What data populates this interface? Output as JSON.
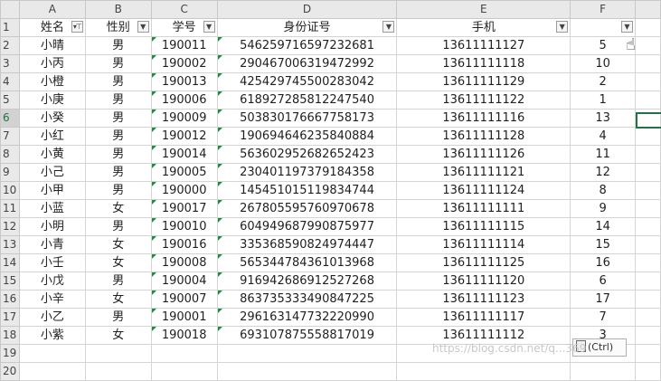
{
  "columns": [
    {
      "letter": "A",
      "header": "姓名",
      "filter_state": "filtered"
    },
    {
      "letter": "B",
      "header": "性别",
      "filter_state": "normal"
    },
    {
      "letter": "C",
      "header": "学号",
      "filter_state": "normal"
    },
    {
      "letter": "D",
      "header": "身份证号",
      "filter_state": "normal"
    },
    {
      "letter": "E",
      "header": "手机",
      "filter_state": "normal"
    },
    {
      "letter": "F",
      "header": "",
      "filter_state": "normal"
    }
  ],
  "rows": [
    {
      "num": "2",
      "name": "小晴",
      "gender": "男",
      "sid": "190011",
      "idcard": "546259716597232681",
      "phone": "13611111127",
      "f": "5"
    },
    {
      "num": "3",
      "name": "小丙",
      "gender": "男",
      "sid": "190002",
      "idcard": "290467006319472992",
      "phone": "13611111118",
      "f": "10"
    },
    {
      "num": "4",
      "name": "小橙",
      "gender": "男",
      "sid": "190013",
      "idcard": "425429745500283042",
      "phone": "13611111129",
      "f": "2"
    },
    {
      "num": "5",
      "name": "小庚",
      "gender": "男",
      "sid": "190006",
      "idcard": "618927285812247540",
      "phone": "13611111122",
      "f": "1"
    },
    {
      "num": "6",
      "name": "小癸",
      "gender": "男",
      "sid": "190009",
      "idcard": "503830176667758173",
      "phone": "13611111116",
      "f": "13"
    },
    {
      "num": "7",
      "name": "小红",
      "gender": "男",
      "sid": "190012",
      "idcard": "190694646235840884",
      "phone": "13611111128",
      "f": "4"
    },
    {
      "num": "8",
      "name": "小黄",
      "gender": "男",
      "sid": "190014",
      "idcard": "563602952682652423",
      "phone": "13611111126",
      "f": "11"
    },
    {
      "num": "9",
      "name": "小己",
      "gender": "男",
      "sid": "190005",
      "idcard": "230401197379184358",
      "phone": "13611111121",
      "f": "12"
    },
    {
      "num": "10",
      "name": "小甲",
      "gender": "男",
      "sid": "190000",
      "idcard": "145451015119834744",
      "phone": "13611111124",
      "f": "8"
    },
    {
      "num": "11",
      "name": "小蓝",
      "gender": "女",
      "sid": "190017",
      "idcard": "267805595760970678",
      "phone": "13611111111",
      "f": "9"
    },
    {
      "num": "12",
      "name": "小明",
      "gender": "男",
      "sid": "190010",
      "idcard": "604949687990875977",
      "phone": "13611111115",
      "f": "14"
    },
    {
      "num": "13",
      "name": "小青",
      "gender": "女",
      "sid": "190016",
      "idcard": "335368590824974447",
      "phone": "13611111114",
      "f": "15"
    },
    {
      "num": "14",
      "name": "小壬",
      "gender": "女",
      "sid": "190008",
      "idcard": "565344784361013968",
      "phone": "13611111125",
      "f": "16"
    },
    {
      "num": "15",
      "name": "小戊",
      "gender": "男",
      "sid": "190004",
      "idcard": "916942686912527268",
      "phone": "13611111120",
      "f": "6"
    },
    {
      "num": "16",
      "name": "小辛",
      "gender": "女",
      "sid": "190007",
      "idcard": "863735333490847225",
      "phone": "13611111123",
      "f": "17"
    },
    {
      "num": "17",
      "name": "小乙",
      "gender": "男",
      "sid": "190001",
      "idcard": "296163147732220990",
      "phone": "13611111117",
      "f": "7"
    },
    {
      "num": "18",
      "name": "小紫",
      "gender": "女",
      "sid": "190018",
      "idcard": "693107875558817019",
      "phone": "13611111112",
      "f": "3"
    }
  ],
  "header_row_num": "1",
  "empty_rows": [
    "19",
    "20"
  ],
  "active_row": "6",
  "paste_options_label": "(Ctrl)",
  "watermark": "https://blog.csdn.net/q...369",
  "accent_color": "#217346",
  "error_indicator_color": "#1a8f3c"
}
